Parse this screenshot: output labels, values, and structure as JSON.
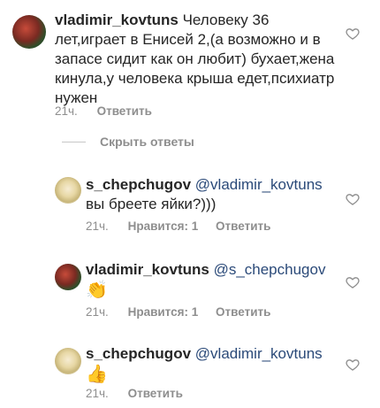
{
  "comments": [
    {
      "username": "vladimir_kovtuns",
      "body": "Человеку 36 лет,играет в Енисей 2,(а возможно и в запасе сидит как он любит) бухает,жена кинула,у человека крыша едет,психиатр нужен",
      "time": "21ч.",
      "reply_label": "Ответить"
    }
  ],
  "hide_replies_label": "Скрыть ответы",
  "replies": [
    {
      "username": "s_chepchugov",
      "mention": "@vladimir_kovtuns",
      "body": "вы бреете яйки?)))",
      "time": "21ч.",
      "likes_label": "Нравится: 1",
      "reply_label": "Ответить"
    },
    {
      "username": "vladimir_kovtuns",
      "mention": "@s_chepchugov",
      "body": "👏",
      "time": "21ч.",
      "likes_label": "Нравится: 1",
      "reply_label": "Ответить"
    },
    {
      "username": "s_chepchugov",
      "mention": "@vladimir_kovtuns",
      "body": "👍",
      "time": "21ч.",
      "reply_label": "Ответить"
    }
  ],
  "icons": {
    "like": "heart-outline-icon"
  },
  "colors": {
    "text": "#262626",
    "meta": "#8e8e8e",
    "mention": "#2b4a79"
  }
}
